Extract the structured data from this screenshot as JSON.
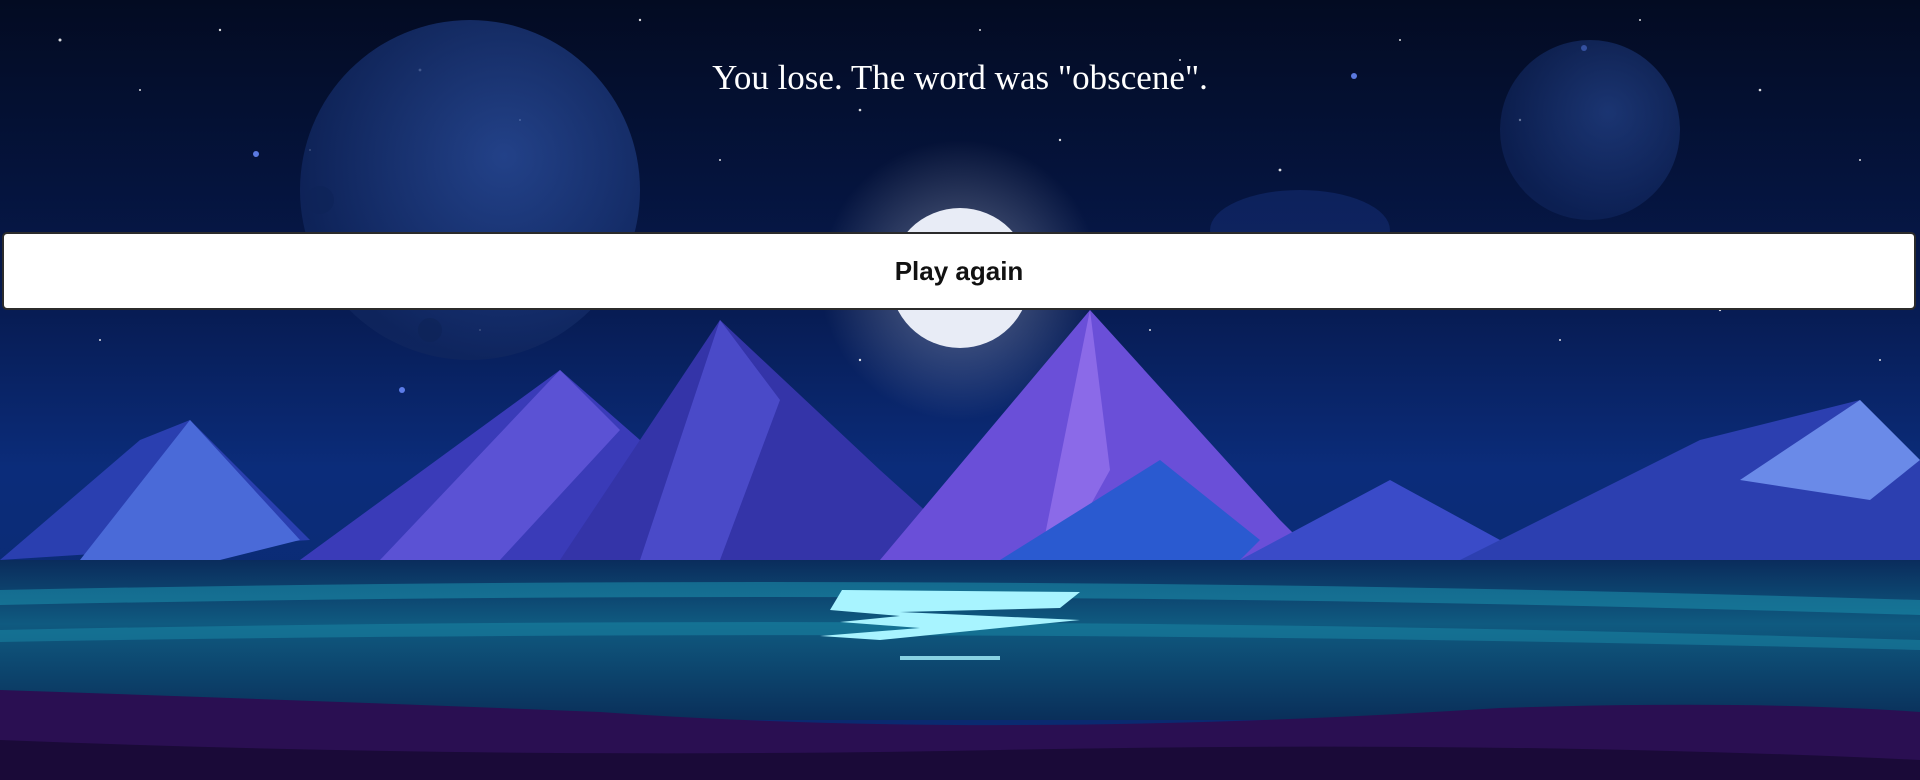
{
  "game": {
    "result_message": "You lose. The word was \"obscene\".",
    "play_again_label": "Play again"
  },
  "colors": {
    "sky_top": "#030b22",
    "sky_mid": "#0a2a6e",
    "moon": "#e8ecf6",
    "mountain_light": "#6a4fd8",
    "mountain_dark": "#2a2aa0",
    "water": "#0f6a8c",
    "water_highlight": "#a8f4ff",
    "shore": "#1c0b3a",
    "button_bg": "#ffffff",
    "text": "#ffffff"
  }
}
